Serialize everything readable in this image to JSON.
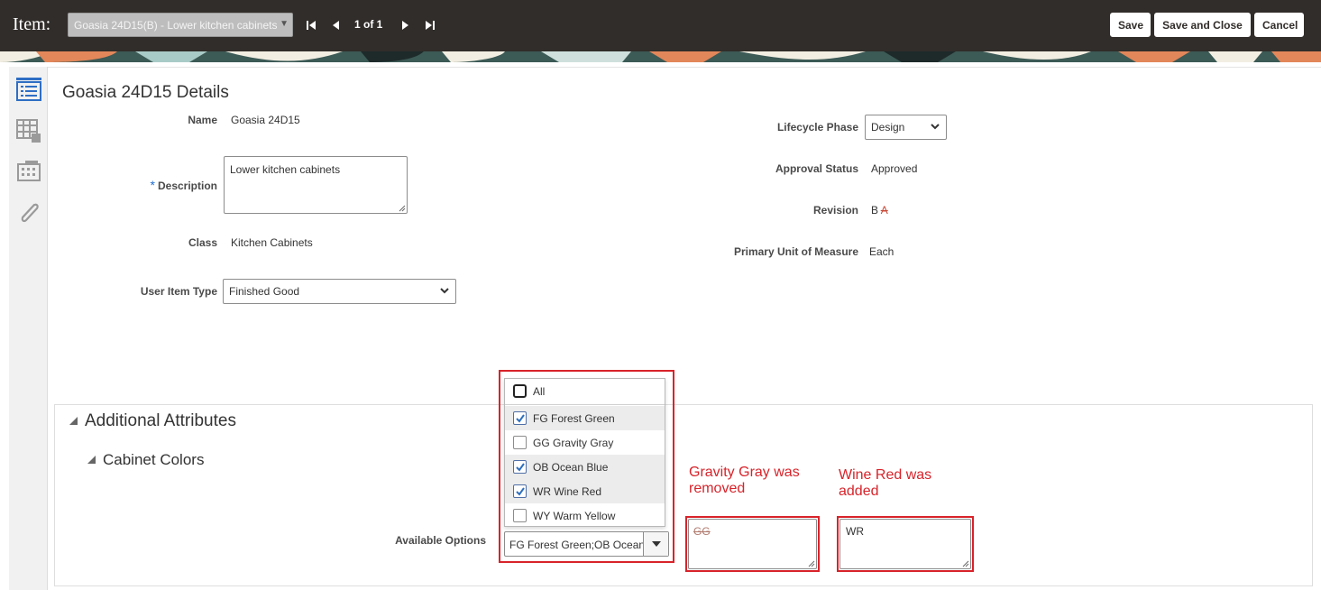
{
  "header": {
    "item_label": "Item:",
    "item_selector_value": "Goasia 24D15(B) - Lower kitchen cabinets",
    "pager_text": "1 of 1",
    "save_label": "Save",
    "save_close_label": "Save and Close",
    "cancel_label": "Cancel"
  },
  "page": {
    "title": "Goasia 24D15 Details"
  },
  "fields": {
    "name_label": "Name",
    "name_value": "Goasia 24D15",
    "required_mark": "*",
    "description_label": "Description",
    "description_value": "Lower kitchen cabinets",
    "class_label": "Class",
    "class_value": "Kitchen Cabinets",
    "user_item_type_label": "User Item Type",
    "user_item_type_value": "Finished Good",
    "lifecycle_label": "Lifecycle Phase",
    "lifecycle_value": "Design",
    "approval_label": "Approval Status",
    "approval_value": "Approved",
    "revision_label": "Revision",
    "revision_current": "B",
    "revision_previous": "A",
    "uom_label": "Primary Unit of Measure",
    "uom_value": "Each"
  },
  "attributes": {
    "section_title": "Additional Attributes",
    "subsection_title": "Cabinet Colors",
    "available_options_label": "Available Options",
    "combo_value": "FG Forest Green;OB Ocean Blue;WR Wine Red",
    "options": [
      {
        "label": "All",
        "checked": false
      },
      {
        "label": "FG Forest Green",
        "checked": true
      },
      {
        "label": "GG Gravity Gray",
        "checked": false
      },
      {
        "label": "OB Ocean Blue",
        "checked": true
      },
      {
        "label": "WR Wine Red",
        "checked": true
      },
      {
        "label": "WY Warm Yellow",
        "checked": false
      }
    ],
    "removed_value": "GG",
    "added_value": "WR"
  },
  "annotations": {
    "removed_note": "Gravity Gray was removed",
    "added_note": "Wine Red was added"
  },
  "colors": {
    "header_bg": "#312d2a",
    "annotation_red": "#d8232a",
    "checkbox_blue": "#2d6fbf"
  }
}
